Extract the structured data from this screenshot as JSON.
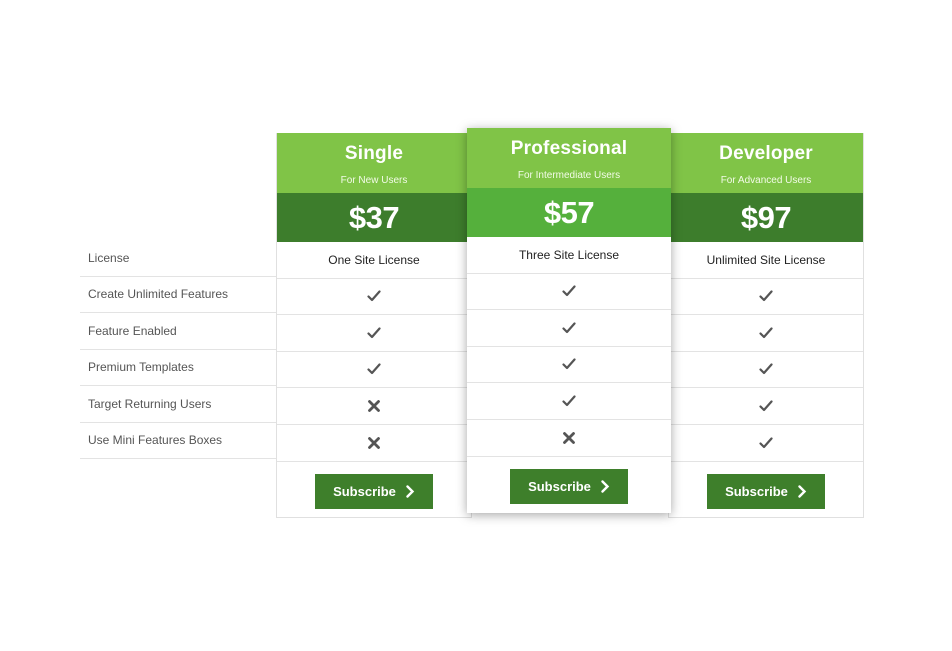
{
  "features": [
    "License",
    "Create Unlimited Features",
    "Feature Enabled",
    "Premium Templates",
    "Target Returning Users",
    "Use Mini Features Boxes"
  ],
  "plans": [
    {
      "name": "Single",
      "subtitle": "For New Users",
      "price": "$37",
      "license": "One Site License",
      "marks": [
        "check",
        "check",
        "check",
        "cross",
        "cross"
      ],
      "button": "Subscribe"
    },
    {
      "name": "Professional",
      "subtitle": "For Intermediate Users",
      "price": "$57",
      "license": "Three Site License",
      "marks": [
        "check",
        "check",
        "check",
        "check",
        "cross"
      ],
      "button": "Subscribe"
    },
    {
      "name": "Developer",
      "subtitle": "For Advanced Users",
      "price": "$97",
      "license": "Unlimited Site License",
      "marks": [
        "check",
        "check",
        "check",
        "check",
        "check"
      ],
      "button": "Subscribe"
    }
  ],
  "colors": {
    "header_green": "#80c447",
    "price_dark_green": "#3d7d2c",
    "price_featured_green": "#55b03c",
    "button_green": "#3e7f2b"
  },
  "icons": {
    "check": "checkmark-icon",
    "cross": "cross-icon",
    "arrow": "chevron-right-icon"
  }
}
